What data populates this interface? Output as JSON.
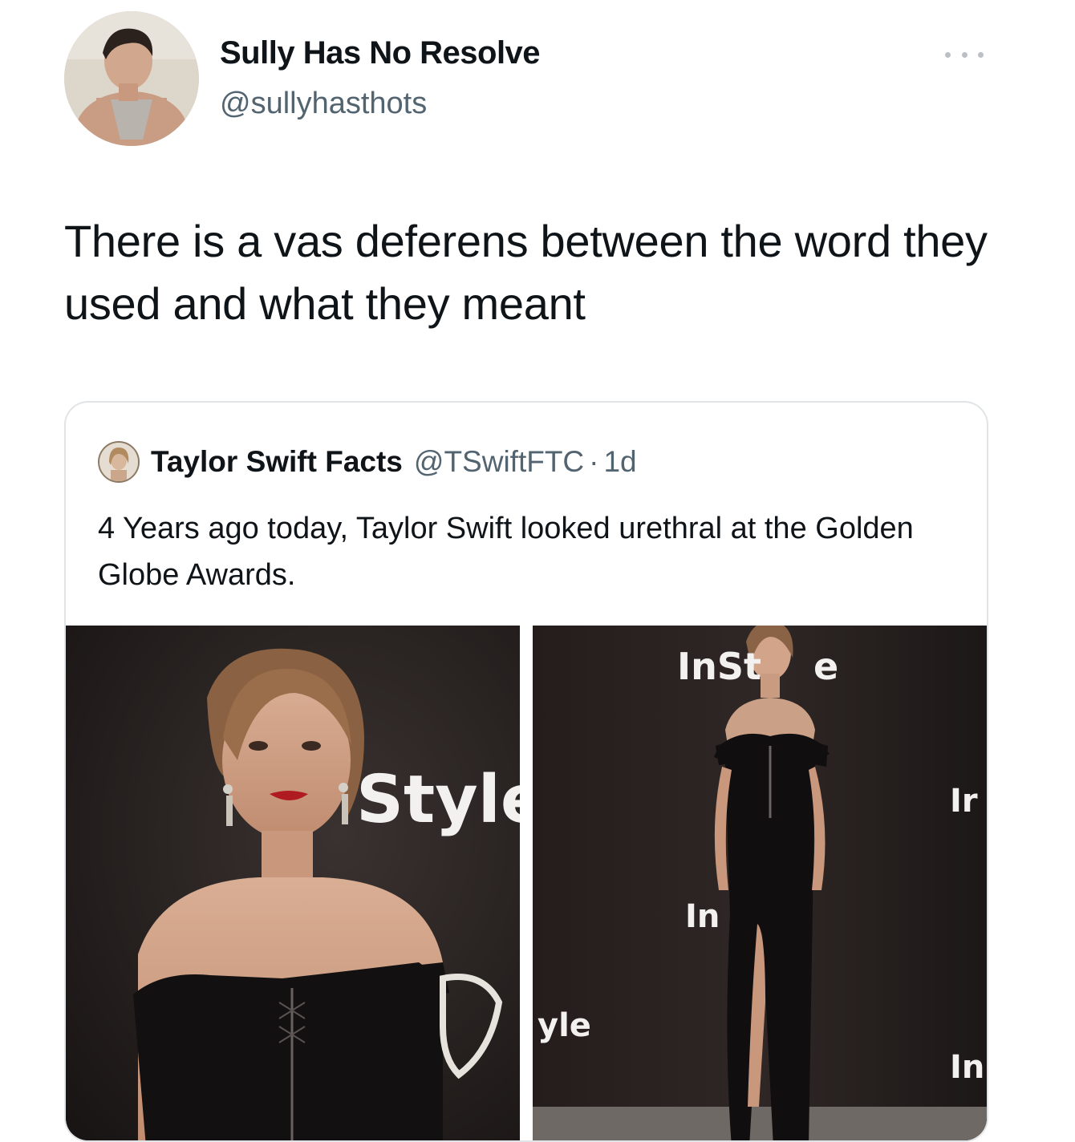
{
  "tweet": {
    "author": {
      "display_name": "Sully Has No Resolve",
      "handle": "@sullyhasthots",
      "avatar_icon": "user-avatar-photo"
    },
    "more_icon": "more-options-icon",
    "text": "There is a vas deferens between the word they used and what they meant"
  },
  "quoted_tweet": {
    "author": {
      "display_name": "Taylor Swift Facts",
      "handle": "@TSwiftFTC",
      "avatar_icon": "account-avatar-photo"
    },
    "separator": "·",
    "time": "1d",
    "text": "4 Years ago today, Taylor Swift looked urethral at the Golden Globe Awards.",
    "media": {
      "photo_left": {
        "backdrop_text": [
          "Style",
          "le"
        ]
      },
      "photo_right": {
        "backdrop_text": [
          "InSt",
          "e",
          "In",
          "yle",
          "Ir",
          "In"
        ]
      }
    }
  },
  "colors": {
    "text_primary": "#0f1419",
    "text_secondary": "#536471",
    "card_border": "#e1e4e6",
    "photo_backdrop": "#1e1a19"
  }
}
